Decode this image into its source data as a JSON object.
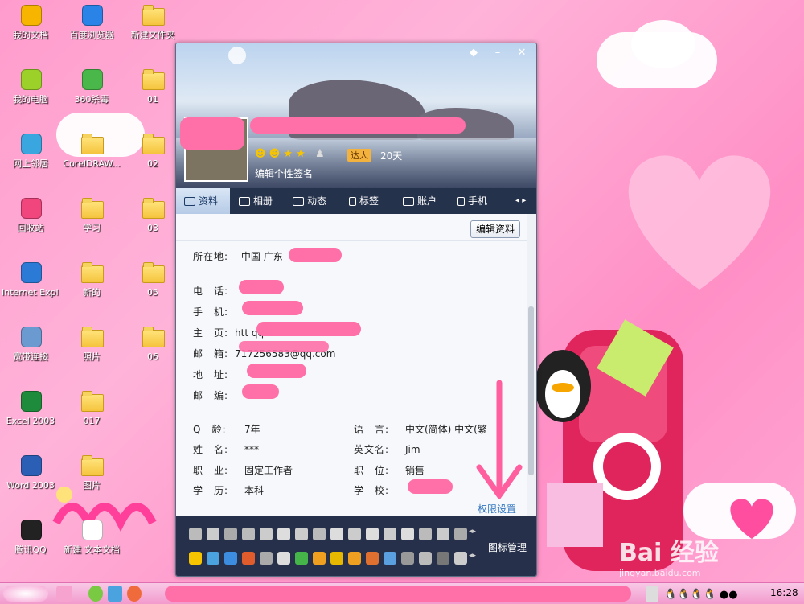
{
  "desktop": {
    "icons": [
      {
        "label": "我的文档",
        "icon": "heart-folder-icon"
      },
      {
        "label": "百度浏览器",
        "icon": "baidu-browser-icon"
      },
      {
        "label": "新建文件夹",
        "icon": "folder-icon"
      },
      {
        "label": "我的电脑",
        "icon": "heart-computer-icon"
      },
      {
        "label": "360杀毒",
        "icon": "shield-icon"
      },
      {
        "label": "01",
        "icon": "folder-icon"
      },
      {
        "label": "网上邻居",
        "icon": "heart-network-icon"
      },
      {
        "label": "CorelDRAW...",
        "icon": "folder-icon"
      },
      {
        "label": "02",
        "icon": "folder-icon"
      },
      {
        "label": "回收站",
        "icon": "heart-recycle-icon"
      },
      {
        "label": "学习",
        "icon": "folder-icon"
      },
      {
        "label": "03",
        "icon": "folder-icon"
      },
      {
        "label": "Internet Explorer",
        "icon": "ie-icon"
      },
      {
        "label": "新的",
        "icon": "folder-icon"
      },
      {
        "label": "05",
        "icon": "folder-icon"
      },
      {
        "label": "宽带连接",
        "icon": "network-connection-icon"
      },
      {
        "label": "照片",
        "icon": "folder-icon"
      },
      {
        "label": "06",
        "icon": "folder-icon"
      },
      {
        "label": "Excel 2003",
        "icon": "excel-icon"
      },
      {
        "label": "017",
        "icon": "folder-icon"
      },
      {
        "label": "Word 2003",
        "icon": "word-icon"
      },
      {
        "label": "图片",
        "icon": "folder-icon"
      },
      {
        "label": "腾讯QQ",
        "icon": "qq-penguin-icon"
      },
      {
        "label": "新建 文本文档",
        "icon": "text-document-icon"
      }
    ]
  },
  "qq": {
    "signature": "编辑个性签名",
    "badge": "达人",
    "days": "20天",
    "tabs": [
      "资料",
      "相册",
      "动态",
      "标签",
      "账户",
      "手机"
    ],
    "edit_button": "编辑资料",
    "location_label": "所在地:",
    "location_value": "中国 广东",
    "contact": [
      {
        "label": "电　话:",
        "value": ""
      },
      {
        "label": "手　机:",
        "value": ""
      },
      {
        "label": "主　页:",
        "value": "htt                    qq.com"
      },
      {
        "label": "邮　箱:",
        "value": "717256583@qq.com"
      },
      {
        "label": "地　址:",
        "value": ""
      },
      {
        "label": "邮　编:",
        "value": ""
      }
    ],
    "left_fields": [
      {
        "label": "Q　龄:",
        "value": "7年"
      },
      {
        "label": "姓　名:",
        "value": "***"
      },
      {
        "label": "职　业:",
        "value": "固定工作者"
      },
      {
        "label": "学　历:",
        "value": "本科"
      }
    ],
    "right_fields": [
      {
        "label": "语　言:",
        "value": "中文(简体)  中文(繁"
      },
      {
        "label": "英文名:",
        "value": "Jim"
      },
      {
        "label": "职　位:",
        "value": "销售"
      },
      {
        "label": "学　校:",
        "value": ""
      }
    ],
    "permission_link": "权限设置",
    "icon_manage": "图标管理"
  },
  "taskbar": {
    "clock": "16:28"
  },
  "watermark": {
    "line1": "Bai  经验",
    "line2": "jingyan.baidu.com"
  },
  "colors": {
    "redaction": "#ff6fa8",
    "tab_bar": "#25324c",
    "accent": "#2f74c0"
  }
}
